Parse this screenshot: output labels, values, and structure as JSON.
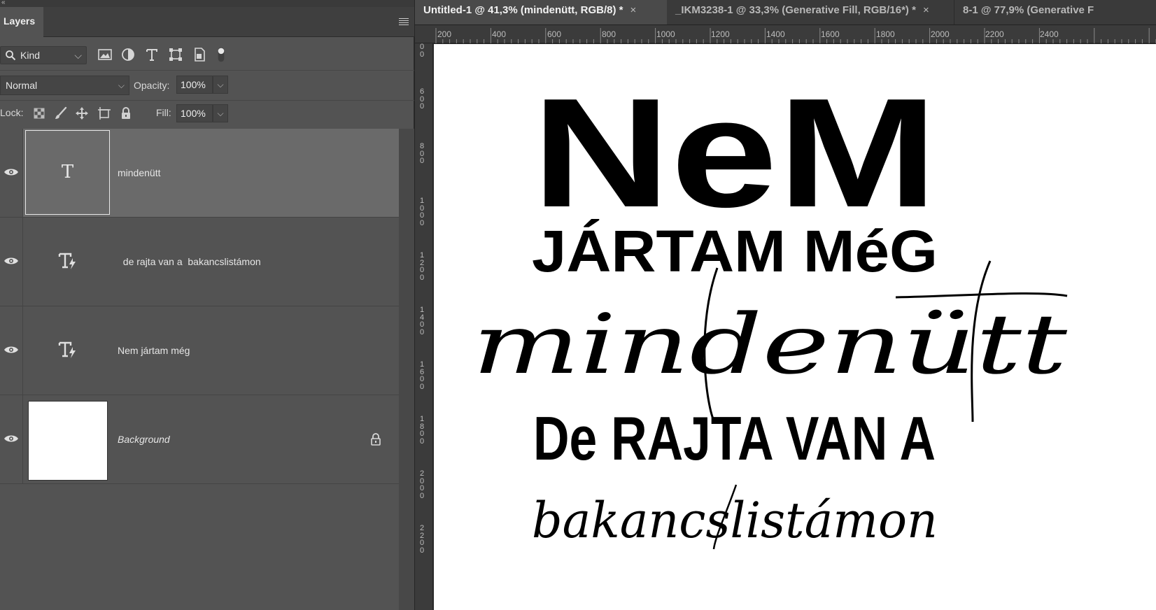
{
  "panel": {
    "collapse_glyph": "«",
    "tab_label": "Layers",
    "menu_icon": "hamburger-menu-icon",
    "filter": {
      "kind_label": "Kind",
      "icons": [
        "image-filter-icon",
        "adjustment-filter-icon",
        "type-filter-icon",
        "shape-filter-icon",
        "smart-object-filter-icon",
        "filter-toggle-icon"
      ]
    },
    "blend_mode": "Normal",
    "opacity_label": "Opacity:",
    "opacity_value": "100%",
    "lock_label": "Lock:",
    "lock_icons": [
      "lock-transparent-icon",
      "lock-paint-icon",
      "lock-position-icon",
      "lock-artboard-icon",
      "lock-all-icon"
    ],
    "fill_label": "Fill:",
    "fill_value": "100%"
  },
  "layers": [
    {
      "name": "mindenütt",
      "type": "text",
      "selected": true,
      "visible": true
    },
    {
      "name": "  de rajta van a  bakancslistámon",
      "type": "text-warning",
      "selected": false,
      "visible": true
    },
    {
      "name": "Nem jártam még",
      "type": "text-warning",
      "selected": false,
      "visible": true
    },
    {
      "name": "Background",
      "type": "background",
      "selected": false,
      "visible": true,
      "locked": true
    }
  ],
  "document": {
    "tabs": [
      {
        "label": "Untitled-1 @ 41,3% (mindenütt, RGB/8) *",
        "active": true
      },
      {
        "label": "_IKM3238-1 @ 33,3% (Generative Fill, RGB/16*) *",
        "active": false
      },
      {
        "label": "8-1 @ 77,9% (Generative F",
        "active": false
      }
    ],
    "close_glyph": "×",
    "ruler_top": [
      "200",
      "400",
      "600",
      "800",
      "1000",
      "1200",
      "1400",
      "1600",
      "1800",
      "2000",
      "2200",
      "2400"
    ],
    "ruler_left": [
      "0 0",
      "6 0 0",
      "8 0 0",
      "1 0 0 0",
      "1 2 0 0",
      "1 4 0 0",
      "1 6 0 0",
      "1 8 0 0",
      "2 0 0 0",
      "2 2 0 0"
    ]
  },
  "artwork": {
    "line1": "NeM",
    "line2": "JÁRTAM MéG",
    "line3": "mindenütt",
    "line4": "De RAJTA VAN A",
    "line5": "bakancslistámon"
  }
}
